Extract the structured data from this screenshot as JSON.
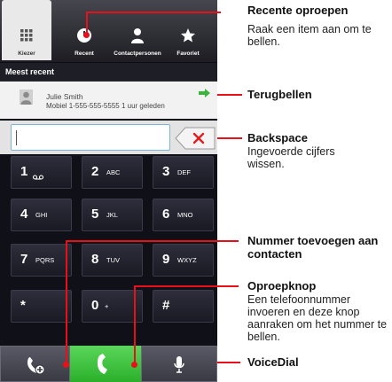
{
  "tabs": [
    {
      "label": "Kiezer",
      "icon": "keypad-grid-icon"
    },
    {
      "label": "Recent",
      "icon": "clock-icon"
    },
    {
      "label": "Contactpersonen",
      "icon": "person-icon"
    },
    {
      "label": "Favoriet",
      "icon": "star-icon"
    }
  ],
  "recent": {
    "header": "Meest recent",
    "name": "Julie Smith",
    "detail": "Mobiel 1-555-555-5555  1 uur geleden"
  },
  "keypad": [
    {
      "digit": "1",
      "letters": ""
    },
    {
      "digit": "2",
      "letters": "ABC"
    },
    {
      "digit": "3",
      "letters": "DEF"
    },
    {
      "digit": "4",
      "letters": "GHI"
    },
    {
      "digit": "5",
      "letters": "JKL"
    },
    {
      "digit": "6",
      "letters": "MNO"
    },
    {
      "digit": "7",
      "letters": "PQRS"
    },
    {
      "digit": "8",
      "letters": "TUV"
    },
    {
      "digit": "9",
      "letters": "WXYZ"
    },
    {
      "digit": "*",
      "letters": ""
    },
    {
      "digit": "0",
      "letters": "+"
    },
    {
      "digit": "#",
      "letters": ""
    }
  ],
  "callouts": {
    "recent": {
      "title": "Recente oproepen",
      "desc": "Raak een item aan om te bellen."
    },
    "callback": {
      "title": "Terugbellen"
    },
    "backspace": {
      "title": "Backspace",
      "desc": "Ingevoerde cijfers wissen."
    },
    "add": {
      "title": "Nummer toevoegen aan contacten"
    },
    "call": {
      "title": "Oproepknop",
      "desc": "Een telefoonnummer invoeren en deze knop aanraken om het nummer te bellen."
    },
    "voice": {
      "title": "VoiceDial"
    }
  },
  "colors": {
    "callout": "#e8101a",
    "call_button": "#2bb02b",
    "redial_arrow": "#3ab43a"
  }
}
